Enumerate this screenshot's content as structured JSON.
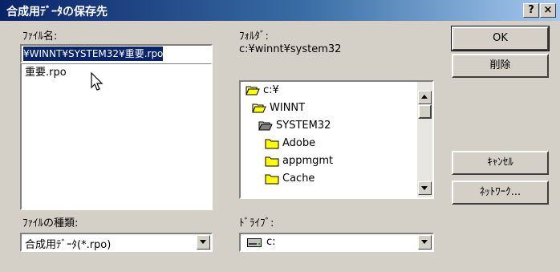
{
  "window": {
    "title": "合成用ﾃﾞｰﾀの保存先",
    "help_button": "?",
    "close_button": "×"
  },
  "filename": {
    "label": "ﾌｧｲﾙ名:",
    "value": "¥WINNT¥SYSTEM32¥重要.rpo",
    "files": [
      "重要.rpo"
    ]
  },
  "folders": {
    "label": "ﾌｫﾙﾀﾞ:",
    "current_path": "c:¥winnt¥system32",
    "items": [
      {
        "name": "c:¥",
        "icon": "open-folder-icon"
      },
      {
        "name": "WINNT",
        "icon": "open-folder-icon"
      },
      {
        "name": "SYSTEM32",
        "icon": "open-folder-icon"
      },
      {
        "name": "Adobe",
        "icon": "folder-icon"
      },
      {
        "name": "appmgmt",
        "icon": "folder-icon"
      },
      {
        "name": "Cache",
        "icon": "folder-icon"
      }
    ]
  },
  "filetype": {
    "label": "ﾌｧｲﾙの種類:",
    "selected": "合成用ﾃﾞｰﾀ(*.rpo)"
  },
  "drive": {
    "label": "ﾄﾞﾗｲﾌﾞ:",
    "selected": "c:",
    "icon": "drive-icon"
  },
  "buttons": {
    "ok": "OK",
    "delete": "削除",
    "cancel": "ｷｬﾝｾﾙ",
    "network": "ﾈｯﾄﾜｰｸ..."
  },
  "colors": {
    "title_start": "#0a246a",
    "title_end": "#a6caf0",
    "selection": "#0a246a",
    "face": "#d4d0c8"
  }
}
